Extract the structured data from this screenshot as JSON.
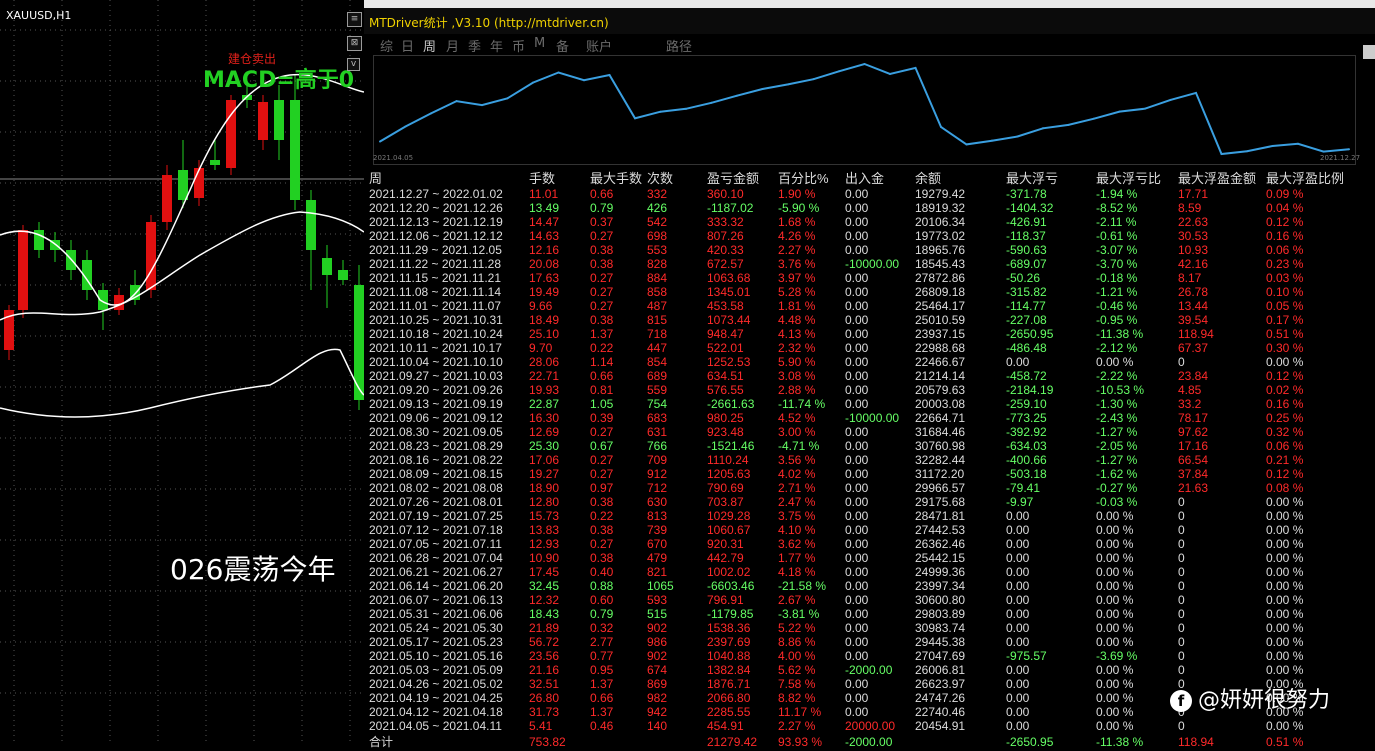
{
  "chart": {
    "symbol": "XAUUSD,H1",
    "signal_small": "建仓卖出",
    "signal_big": "MACD=高于0",
    "overlay_caption": "026震荡今年"
  },
  "panel": {
    "title": "MTDriver统计 ,V3.10 (http://mtdriver.cn)",
    "tabs": [
      "综",
      "日",
      "周",
      "月",
      "季",
      "年",
      "币",
      "M",
      "备",
      "账户",
      "路径"
    ],
    "active_tab": "周",
    "equity_start_date": "2021.04.05",
    "equity_end_date": "2021.12.27",
    "columns": [
      "周",
      "手数",
      "最大手数",
      "次数",
      "盈亏金额",
      "百分比%",
      "出入金",
      "余额",
      "最大浮亏",
      "最大浮亏比",
      "最大浮盈金额",
      "最大浮盈比例"
    ],
    "rows": [
      [
        "2021.12.27 ~ 2022.01.02",
        "11.01",
        "0.66",
        "332",
        "360.10",
        "1.90 %",
        "0.00",
        "19279.42",
        "-371.78",
        "-1.94 %",
        "17.71",
        "0.09 %"
      ],
      [
        "2021.12.20 ~ 2021.12.26",
        "13.49",
        "0.79",
        "426",
        "-1187.02",
        "-5.90 %",
        "0.00",
        "18919.32",
        "-1404.32",
        "-8.52 %",
        "8.59",
        "0.04 %"
      ],
      [
        "2021.12.13 ~ 2021.12.19",
        "14.47",
        "0.37",
        "542",
        "333.32",
        "1.68 %",
        "0.00",
        "20106.34",
        "-426.91",
        "-2.11 %",
        "22.63",
        "0.12 %"
      ],
      [
        "2021.12.06 ~ 2021.12.12",
        "14.63",
        "0.27",
        "698",
        "807.26",
        "4.26 %",
        "0.00",
        "19773.02",
        "-118.37",
        "-0.61 %",
        "30.53",
        "0.16 %"
      ],
      [
        "2021.11.29 ~ 2021.12.05",
        "12.16",
        "0.38",
        "553",
        "420.33",
        "2.27 %",
        "0.00",
        "18965.76",
        "-590.63",
        "-3.07 %",
        "10.93",
        "0.06 %"
      ],
      [
        "2021.11.22 ~ 2021.11.28",
        "20.08",
        "0.38",
        "828",
        "672.57",
        "3.76 %",
        "-10000.00",
        "18545.43",
        "-689.07",
        "-3.70 %",
        "42.16",
        "0.23 %"
      ],
      [
        "2021.11.15 ~ 2021.11.21",
        "17.63",
        "0.27",
        "884",
        "1063.68",
        "3.97 %",
        "0.00",
        "27872.86",
        "-50.26",
        "-0.18 %",
        "8.17",
        "0.03 %"
      ],
      [
        "2021.11.08 ~ 2021.11.14",
        "19.49",
        "0.27",
        "858",
        "1345.01",
        "5.28 %",
        "0.00",
        "26809.18",
        "-315.82",
        "-1.21 %",
        "26.78",
        "0.10 %"
      ],
      [
        "2021.11.01 ~ 2021.11.07",
        "9.66",
        "0.27",
        "487",
        "453.58",
        "1.81 %",
        "0.00",
        "25464.17",
        "-114.77",
        "-0.46 %",
        "13.44",
        "0.05 %"
      ],
      [
        "2021.10.25 ~ 2021.10.31",
        "18.49",
        "0.38",
        "815",
        "1073.44",
        "4.48 %",
        "0.00",
        "25010.59",
        "-227.08",
        "-0.95 %",
        "39.54",
        "0.17 %"
      ],
      [
        "2021.10.18 ~ 2021.10.24",
        "25.10",
        "1.37",
        "718",
        "948.47",
        "4.13 %",
        "0.00",
        "23937.15",
        "-2650.95",
        "-11.38 %",
        "118.94",
        "0.51 %"
      ],
      [
        "2021.10.11 ~ 2021.10.17",
        "9.70",
        "0.22",
        "447",
        "522.01",
        "2.32 %",
        "0.00",
        "22988.68",
        "-486.48",
        "-2.12 %",
        "67.37",
        "0.30 %"
      ],
      [
        "2021.10.04 ~ 2021.10.10",
        "28.06",
        "1.14",
        "854",
        "1252.53",
        "5.90 %",
        "0.00",
        "22466.67",
        "0.00",
        "0.00 %",
        "0",
        "0.00 %"
      ],
      [
        "2021.09.27 ~ 2021.10.03",
        "22.71",
        "0.66",
        "689",
        "634.51",
        "3.08 %",
        "0.00",
        "21214.14",
        "-458.72",
        "-2.22 %",
        "23.84",
        "0.12 %"
      ],
      [
        "2021.09.20 ~ 2021.09.26",
        "19.93",
        "0.81",
        "559",
        "576.55",
        "2.88 %",
        "0.00",
        "20579.63",
        "-2184.19",
        "-10.53 %",
        "4.85",
        "0.02 %"
      ],
      [
        "2021.09.13 ~ 2021.09.19",
        "22.87",
        "1.05",
        "754",
        "-2661.63",
        "-11.74 %",
        "0.00",
        "20003.08",
        "-259.10",
        "-1.30 %",
        "33.2",
        "0.16 %"
      ],
      [
        "2021.09.06 ~ 2021.09.12",
        "16.30",
        "0.39",
        "683",
        "980.25",
        "4.52 %",
        "-10000.00",
        "22664.71",
        "-773.25",
        "-2.43 %",
        "78.17",
        "0.25 %"
      ],
      [
        "2021.08.30 ~ 2021.09.05",
        "12.69",
        "0.27",
        "631",
        "923.48",
        "3.00 %",
        "0.00",
        "31684.46",
        "-392.92",
        "-1.27 %",
        "97.62",
        "0.32 %"
      ],
      [
        "2021.08.23 ~ 2021.08.29",
        "25.30",
        "0.67",
        "766",
        "-1521.46",
        "-4.71 %",
        "0.00",
        "30760.98",
        "-634.03",
        "-2.05 %",
        "17.16",
        "0.06 %"
      ],
      [
        "2021.08.16 ~ 2021.08.22",
        "17.06",
        "0.27",
        "709",
        "1110.24",
        "3.56 %",
        "0.00",
        "32282.44",
        "-400.66",
        "-1.27 %",
        "66.54",
        "0.21 %"
      ],
      [
        "2021.08.09 ~ 2021.08.15",
        "19.27",
        "0.27",
        "912",
        "1205.63",
        "4.02 %",
        "0.00",
        "31172.20",
        "-503.18",
        "-1.62 %",
        "37.84",
        "0.12 %"
      ],
      [
        "2021.08.02 ~ 2021.08.08",
        "18.90",
        "0.97",
        "712",
        "790.69",
        "2.71 %",
        "0.00",
        "29966.57",
        "-79.41",
        "-0.27 %",
        "21.63",
        "0.08 %"
      ],
      [
        "2021.07.26 ~ 2021.08.01",
        "12.80",
        "0.38",
        "630",
        "703.87",
        "2.47 %",
        "0.00",
        "29175.68",
        "-9.97",
        "-0.03 %",
        "0",
        "0.00 %"
      ],
      [
        "2021.07.19 ~ 2021.07.25",
        "15.73",
        "0.22",
        "813",
        "1029.28",
        "3.75 %",
        "0.00",
        "28471.81",
        "0.00",
        "0.00 %",
        "0",
        "0.00 %"
      ],
      [
        "2021.07.12 ~ 2021.07.18",
        "13.83",
        "0.38",
        "739",
        "1060.67",
        "4.10 %",
        "0.00",
        "27442.53",
        "0.00",
        "0.00 %",
        "0",
        "0.00 %"
      ],
      [
        "2021.07.05 ~ 2021.07.11",
        "12.93",
        "0.27",
        "670",
        "920.31",
        "3.62 %",
        "0.00",
        "26362.46",
        "0.00",
        "0.00 %",
        "0",
        "0.00 %"
      ],
      [
        "2021.06.28 ~ 2021.07.04",
        "10.90",
        "0.38",
        "479",
        "442.79",
        "1.77 %",
        "0.00",
        "25442.15",
        "0.00",
        "0.00 %",
        "0",
        "0.00 %"
      ],
      [
        "2021.06.21 ~ 2021.06.27",
        "17.45",
        "0.40",
        "821",
        "1002.02",
        "4.18 %",
        "0.00",
        "24999.36",
        "0.00",
        "0.00 %",
        "0",
        "0.00 %"
      ],
      [
        "2021.06.14 ~ 2021.06.20",
        "32.45",
        "0.88",
        "1065",
        "-6603.46",
        "-21.58 %",
        "0.00",
        "23997.34",
        "0.00",
        "0.00 %",
        "0",
        "0.00 %"
      ],
      [
        "2021.06.07 ~ 2021.06.13",
        "12.32",
        "0.60",
        "593",
        "796.91",
        "2.67 %",
        "0.00",
        "30600.80",
        "0.00",
        "0.00 %",
        "0",
        "0.00 %"
      ],
      [
        "2021.05.31 ~ 2021.06.06",
        "18.43",
        "0.79",
        "515",
        "-1179.85",
        "-3.81 %",
        "0.00",
        "29803.89",
        "0.00",
        "0.00 %",
        "0",
        "0.00 %"
      ],
      [
        "2021.05.24 ~ 2021.05.30",
        "21.89",
        "0.32",
        "902",
        "1538.36",
        "5.22 %",
        "0.00",
        "30983.74",
        "0.00",
        "0.00 %",
        "0",
        "0.00 %"
      ],
      [
        "2021.05.17 ~ 2021.05.23",
        "56.72",
        "2.77",
        "986",
        "2397.69",
        "8.86 %",
        "0.00",
        "29445.38",
        "0.00",
        "0.00 %",
        "0",
        "0.00 %"
      ],
      [
        "2021.05.10 ~ 2021.05.16",
        "23.56",
        "0.77",
        "902",
        "1040.88",
        "4.00 %",
        "0.00",
        "27047.69",
        "-975.57",
        "-3.69 %",
        "0",
        "0.00 %"
      ],
      [
        "2021.05.03 ~ 2021.05.09",
        "21.16",
        "0.95",
        "674",
        "1382.84",
        "5.62 %",
        "-2000.00",
        "26006.81",
        "0.00",
        "0.00 %",
        "0",
        "0.00 %"
      ],
      [
        "2021.04.26 ~ 2021.05.02",
        "32.51",
        "1.37",
        "869",
        "1876.71",
        "7.58 %",
        "0.00",
        "26623.97",
        "0.00",
        "0.00 %",
        "0",
        "0.00 %"
      ],
      [
        "2021.04.19 ~ 2021.04.25",
        "26.80",
        "0.66",
        "982",
        "2066.80",
        "8.82 %",
        "0.00",
        "24747.26",
        "0.00",
        "0.00 %",
        "0",
        "0.00 %"
      ],
      [
        "2021.04.12 ~ 2021.04.18",
        "31.73",
        "1.37",
        "942",
        "2285.55",
        "11.17 %",
        "0.00",
        "22740.46",
        "0.00",
        "0.00 %",
        "0",
        "0.00 %"
      ],
      [
        "2021.04.05 ~ 2021.04.11",
        "5.41",
        "0.46",
        "140",
        "454.91",
        "2.27 %",
        "20000.00",
        "20454.91",
        "0.00",
        "0.00 %",
        "0",
        "0.00 %"
      ]
    ],
    "total": [
      "合计",
      "753.82",
      "",
      "",
      "21279.42",
      "93.93 %",
      "-2000.00",
      "",
      "-2650.95",
      "-11.38 %",
      "118.94",
      "0.51 %"
    ]
  },
  "watermark": {
    "icon": "f",
    "text": "@妍妍很努力"
  },
  "colors": {
    "positive": "#ff2a2a",
    "negative": "#66ff66",
    "neutral": "#dcdcdc",
    "equity_line": "#3a9fe0",
    "candle_up": "#e01010",
    "candle_down": "#22d022",
    "title": "#f0d200"
  },
  "chart_data": {
    "type": "line",
    "x": [
      "2021.04.05",
      "2021.04.12",
      "2021.04.19",
      "2021.04.26",
      "2021.05.03",
      "2021.05.10",
      "2021.05.17",
      "2021.05.24",
      "2021.05.31",
      "2021.06.07",
      "2021.06.14",
      "2021.06.21",
      "2021.06.28",
      "2021.07.05",
      "2021.07.12",
      "2021.07.19",
      "2021.07.26",
      "2021.08.02",
      "2021.08.09",
      "2021.08.16",
      "2021.08.23",
      "2021.08.30",
      "2021.09.06",
      "2021.09.13",
      "2021.09.20",
      "2021.09.27",
      "2021.10.04",
      "2021.10.11",
      "2021.10.18",
      "2021.10.25",
      "2021.11.01",
      "2021.11.08",
      "2021.11.15",
      "2021.11.22",
      "2021.11.29",
      "2021.12.06",
      "2021.12.13",
      "2021.12.20",
      "2021.12.27"
    ],
    "series": [
      {
        "values": [
          20454.91,
          22740.46,
          24747.26,
          26623.97,
          26006.81,
          27047.69,
          29445.38,
          30983.74,
          29803.89,
          30600.8,
          23997.34,
          24999.36,
          25442.15,
          26362.46,
          27442.53,
          28471.81,
          29175.68,
          29966.57,
          31172.2,
          32282.44,
          30760.98,
          31684.46,
          22664.71,
          20003.08,
          20579.63,
          21214.14,
          22466.67,
          22988.68,
          23937.15,
          25010.59,
          25464.17,
          26809.18,
          27872.86,
          18545.43,
          18965.76,
          19773.02,
          20106.34,
          18919.32,
          19279.42
        ]
      }
    ]
  }
}
